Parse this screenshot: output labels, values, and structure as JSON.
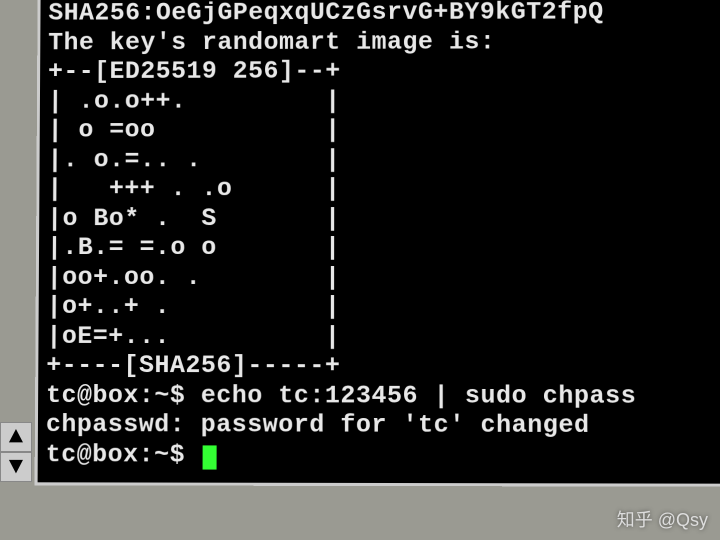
{
  "terminal": {
    "lines": [
      "SHA256:OeGjGPeqxqUCzGsrvG+BY9kGT2fpQ",
      "The key's randomart image is:",
      "+--[ED25519 256]--+",
      "| .o.o++.         |",
      "| o =oo           |",
      "|. o.=.. .        |",
      "|   +++ . .o      |",
      "|o Bo* .  S       |",
      "|.B.= =.o o       |",
      "|oo+.oo. .        |",
      "|o+..+ .          |",
      "|oE=+...          |",
      "+----[SHA256]-----+",
      "tc@box:~$ echo tc:123456 | sudo chpass",
      "chpasswd: password for 'tc' changed",
      "tc@box:~$ "
    ]
  },
  "scroll": {
    "up": "▲",
    "down": "▼"
  },
  "watermark": "知乎 @Qsy"
}
